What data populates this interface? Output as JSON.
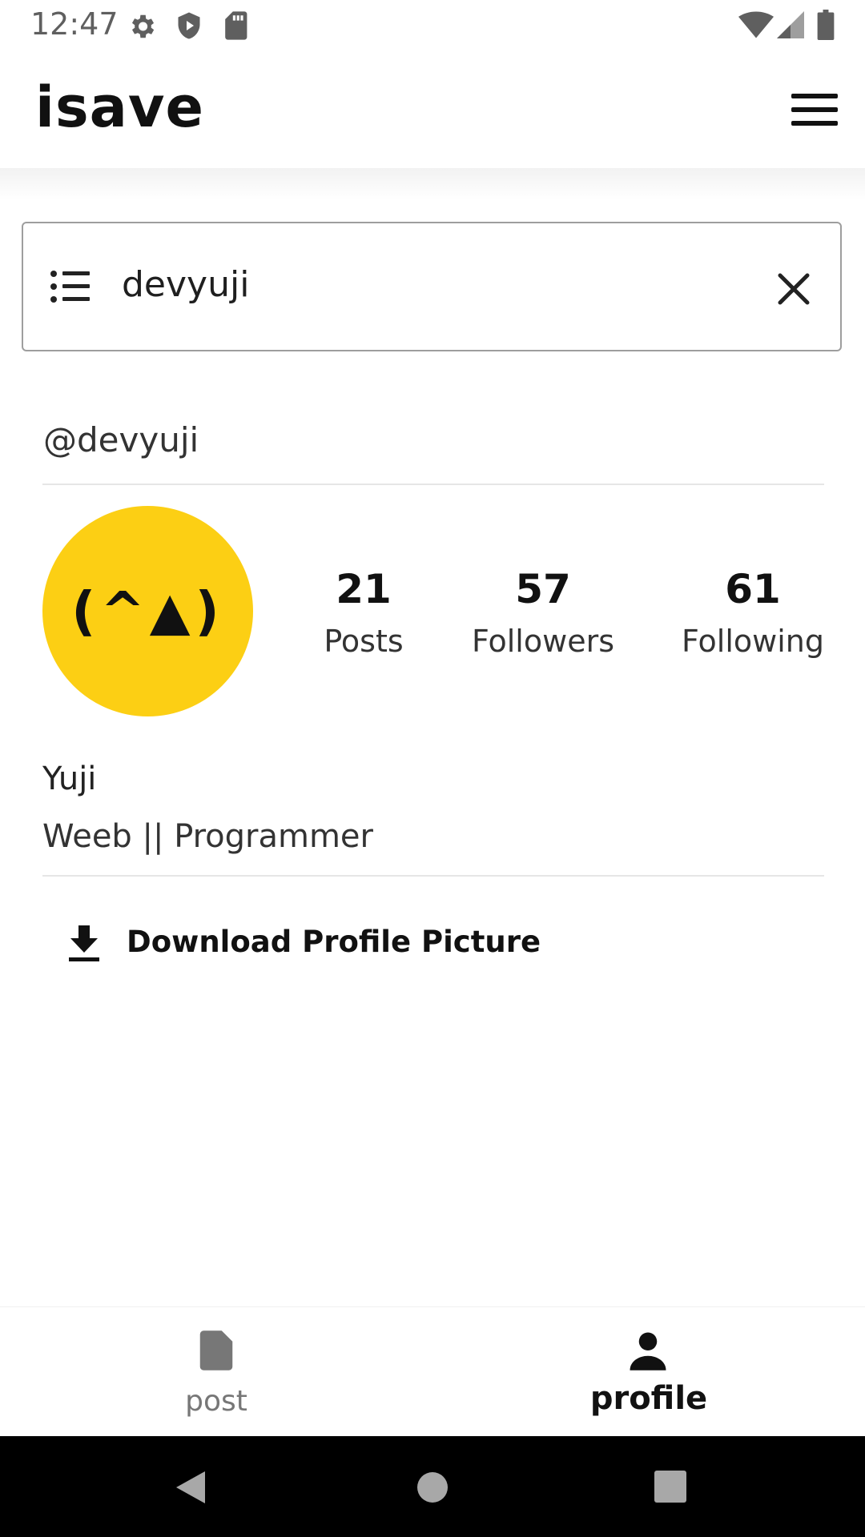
{
  "status_bar": {
    "time": "12:47",
    "icons": [
      "gear-icon",
      "shield-icon",
      "sd-card-icon",
      "wifi-icon",
      "signal-icon",
      "battery-icon"
    ]
  },
  "app_bar": {
    "title": "isave",
    "menu_icon": "hamburger-menu-icon"
  },
  "search": {
    "value": "devyuji",
    "leading_icon": "list-icon",
    "trailing_icon": "close-icon"
  },
  "profile": {
    "handle": "@devyuji",
    "avatar_text": "(^▲)",
    "avatar_color": "#fccf14",
    "stats": [
      {
        "value": "21",
        "label": "Posts"
      },
      {
        "value": "57",
        "label": "Followers"
      },
      {
        "value": "61",
        "label": "Following"
      }
    ],
    "name": "Yuji",
    "bio": "Weeb || Programmer",
    "download_label": "Download Profile Picture"
  },
  "bottom_nav": {
    "items": [
      {
        "label": "post",
        "icon": "document-icon",
        "active": false
      },
      {
        "label": "profile",
        "icon": "person-icon",
        "active": true
      }
    ]
  },
  "system_nav": {
    "icons": [
      "back-icon",
      "home-icon",
      "recents-icon"
    ]
  }
}
